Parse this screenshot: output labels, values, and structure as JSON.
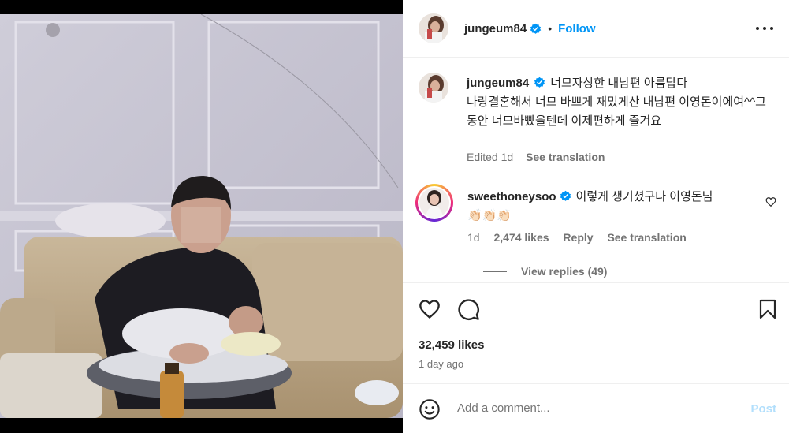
{
  "post": {
    "author": "jungeum84",
    "follow_label": "Follow",
    "separator": "•",
    "caption_line1": "너므자상한 내남편 아름답다",
    "caption_line2": "나랑결혼해서 너므 바쁘게 재밌게산 내남편 이영돈이에여^^그동안 너므바빴을텐데 이제편하게 즐겨요",
    "edited_label": "Edited",
    "caption_age": "1d",
    "see_translation": "See translation",
    "likes": "32,459 likes",
    "posted_ago": "1 day ago"
  },
  "comment": {
    "author": "sweethoneysoo",
    "text": "이렇게 생기셨구나 이영돈님",
    "emoji": "👏🏻👏🏻👏🏻",
    "age": "1d",
    "likes": "2,474 likes",
    "reply_label": "Reply",
    "see_translation": "See translation",
    "view_replies": "View replies (49)"
  },
  "composer": {
    "placeholder": "Add a comment...",
    "post_label": "Post"
  },
  "icons": {
    "verified": "verified-badge-icon",
    "more": "more-options-icon",
    "like": "heart-icon",
    "comment": "comment-bubble-icon",
    "save": "bookmark-icon",
    "emoji": "emoji-smiley-icon"
  },
  "colors": {
    "accent": "#0095f6",
    "post_disabled": "#b2dffc",
    "muted": "#737373",
    "text": "#262626"
  }
}
